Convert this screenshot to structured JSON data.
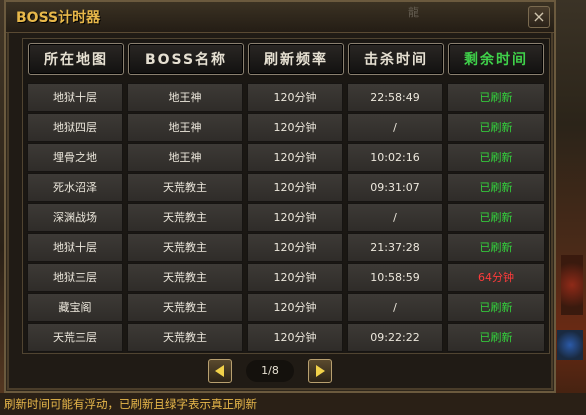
{
  "window": {
    "title": "BOSS计时器",
    "close_label": "×",
    "decoration": "龍"
  },
  "headers": [
    {
      "label": "所在地图",
      "active": false
    },
    {
      "label": "BOSS名称",
      "active": false
    },
    {
      "label": "刷新频率",
      "active": false
    },
    {
      "label": "击杀时间",
      "active": false
    },
    {
      "label": "剩余时间",
      "active": true
    }
  ],
  "rows": [
    {
      "map": "地狱十层",
      "boss": "地王神",
      "freq": "120分钟",
      "kill": "22:58:49",
      "remain": "已刷新",
      "status": "refreshed"
    },
    {
      "map": "地狱四层",
      "boss": "地王神",
      "freq": "120分钟",
      "kill": "/",
      "remain": "已刷新",
      "status": "refreshed"
    },
    {
      "map": "埋骨之地",
      "boss": "地王神",
      "freq": "120分钟",
      "kill": "10:02:16",
      "remain": "已刷新",
      "status": "refreshed"
    },
    {
      "map": "死水沼泽",
      "boss": "天荒教主",
      "freq": "120分钟",
      "kill": "09:31:07",
      "remain": "已刷新",
      "status": "refreshed"
    },
    {
      "map": "深渊战场",
      "boss": "天荒教主",
      "freq": "120分钟",
      "kill": "/",
      "remain": "已刷新",
      "status": "refreshed"
    },
    {
      "map": "地狱十层",
      "boss": "天荒教主",
      "freq": "120分钟",
      "kill": "21:37:28",
      "remain": "已刷新",
      "status": "refreshed"
    },
    {
      "map": "地狱三层",
      "boss": "天荒教主",
      "freq": "120分钟",
      "kill": "10:58:59",
      "remain": "64分钟",
      "status": "pending"
    },
    {
      "map": "藏宝阁",
      "boss": "天荒教主",
      "freq": "120分钟",
      "kill": "/",
      "remain": "已刷新",
      "status": "refreshed"
    },
    {
      "map": "天荒三层",
      "boss": "天荒教主",
      "freq": "120分钟",
      "kill": "09:22:22",
      "remain": "已刷新",
      "status": "refreshed"
    }
  ],
  "pagination": {
    "page_label": "1/8"
  },
  "footer": {
    "note": "刷新时间可能有浮动，已刷新且绿字表示真正刷新"
  },
  "colors": {
    "refreshed": "#33d43c",
    "pending": "#ff3b3b",
    "title": "#e8b84a"
  }
}
